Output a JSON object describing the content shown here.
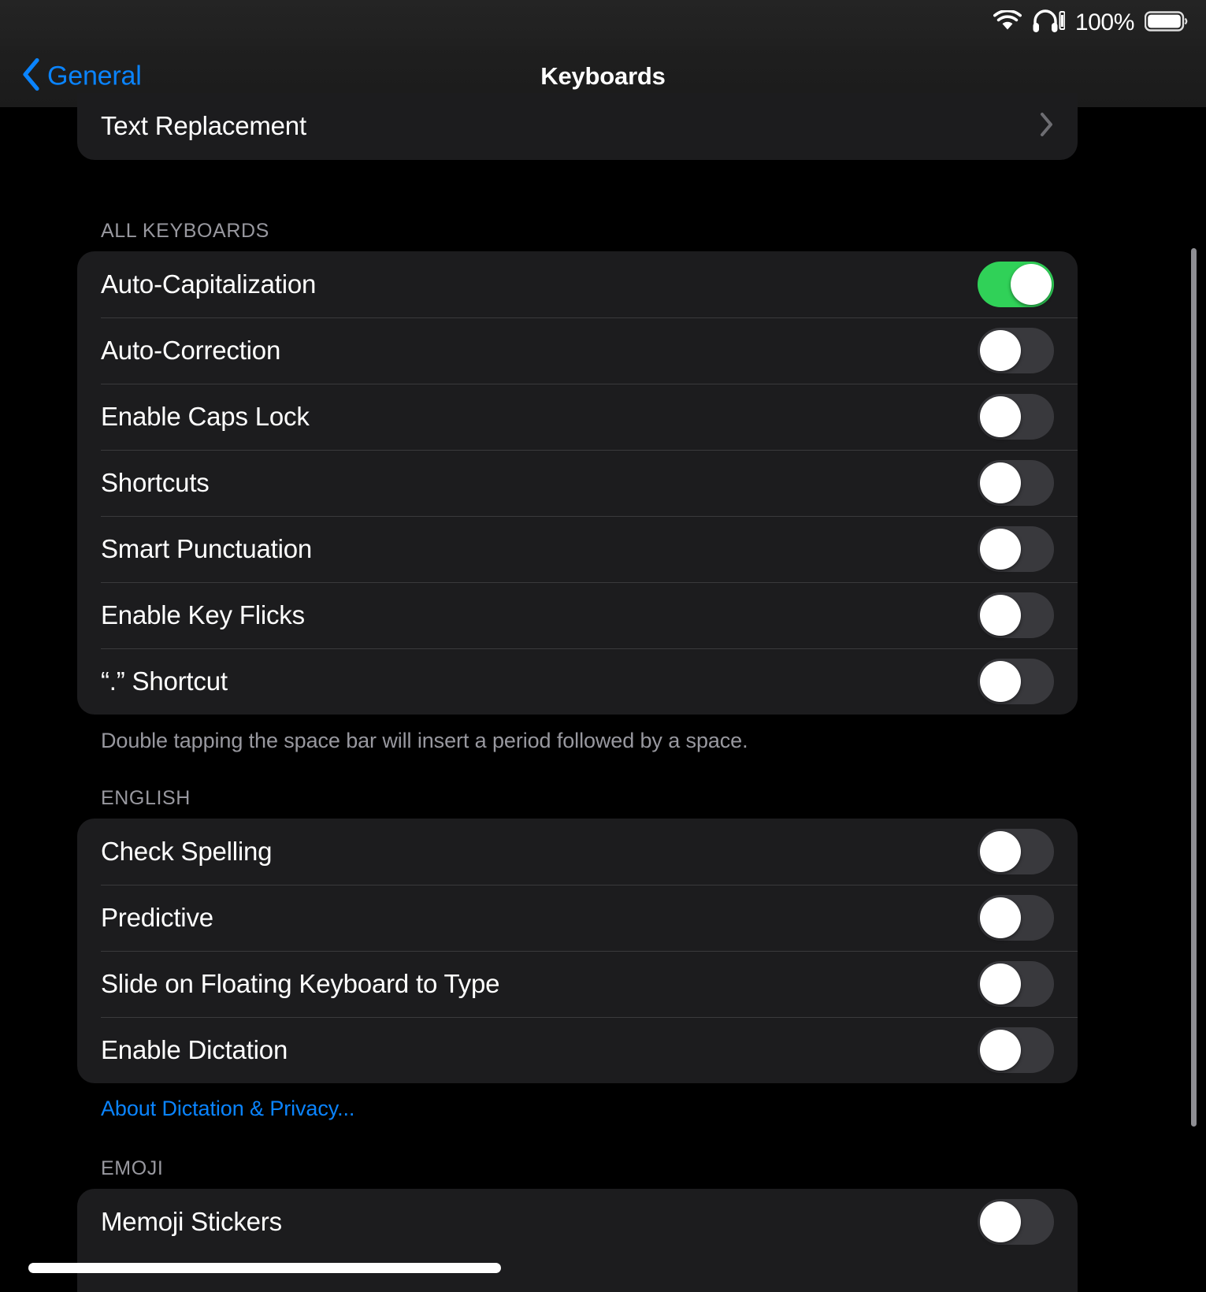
{
  "status_bar": {
    "wifi_icon": "wifi-icon",
    "headphones_icon": "headphones-icon",
    "battery_percent": "100%",
    "battery_icon": "battery-full-icon"
  },
  "nav": {
    "back_icon": "chevron-left-icon",
    "back_label": "General",
    "title": "Keyboards"
  },
  "sections": [
    {
      "header": "",
      "footer": "",
      "rows": [
        {
          "label": "Text Replacement",
          "accessory": "disclosure",
          "accessory_icon": "chevron-right-icon"
        }
      ]
    },
    {
      "header": "ALL KEYBOARDS",
      "footer": "Double tapping the space bar will insert a period followed by a space.",
      "rows": [
        {
          "label": "Auto-Capitalization",
          "accessory": "toggle",
          "on": true
        },
        {
          "label": "Auto-Correction",
          "accessory": "toggle",
          "on": false
        },
        {
          "label": "Enable Caps Lock",
          "accessory": "toggle",
          "on": false
        },
        {
          "label": "Shortcuts",
          "accessory": "toggle",
          "on": false
        },
        {
          "label": "Smart Punctuation",
          "accessory": "toggle",
          "on": false
        },
        {
          "label": "Enable Key Flicks",
          "accessory": "toggle",
          "on": false
        },
        {
          "label": "“.” Shortcut",
          "accessory": "toggle",
          "on": false
        }
      ]
    },
    {
      "header": "ENGLISH",
      "footer": "About Dictation & Privacy...",
      "rows": [
        {
          "label": "Check Spelling",
          "accessory": "toggle",
          "on": false
        },
        {
          "label": "Predictive",
          "accessory": "toggle",
          "on": false
        },
        {
          "label": "Slide on Floating Keyboard to Type",
          "accessory": "toggle",
          "on": false
        },
        {
          "label": "Enable Dictation",
          "accessory": "toggle",
          "on": false
        }
      ]
    },
    {
      "header": "EMOJI",
      "footer": "",
      "rows": [
        {
          "label": "Memoji Stickers",
          "accessory": "toggle",
          "on": false
        }
      ]
    }
  ],
  "colors": {
    "accent_blue": "#0a84ff",
    "toggle_on_green": "#30d158",
    "toggle_off_gray": "#39393d",
    "card_background": "#1c1c1e",
    "page_background": "#000000",
    "secondary_label": "#98989f",
    "separator": "#3a3a3c"
  }
}
